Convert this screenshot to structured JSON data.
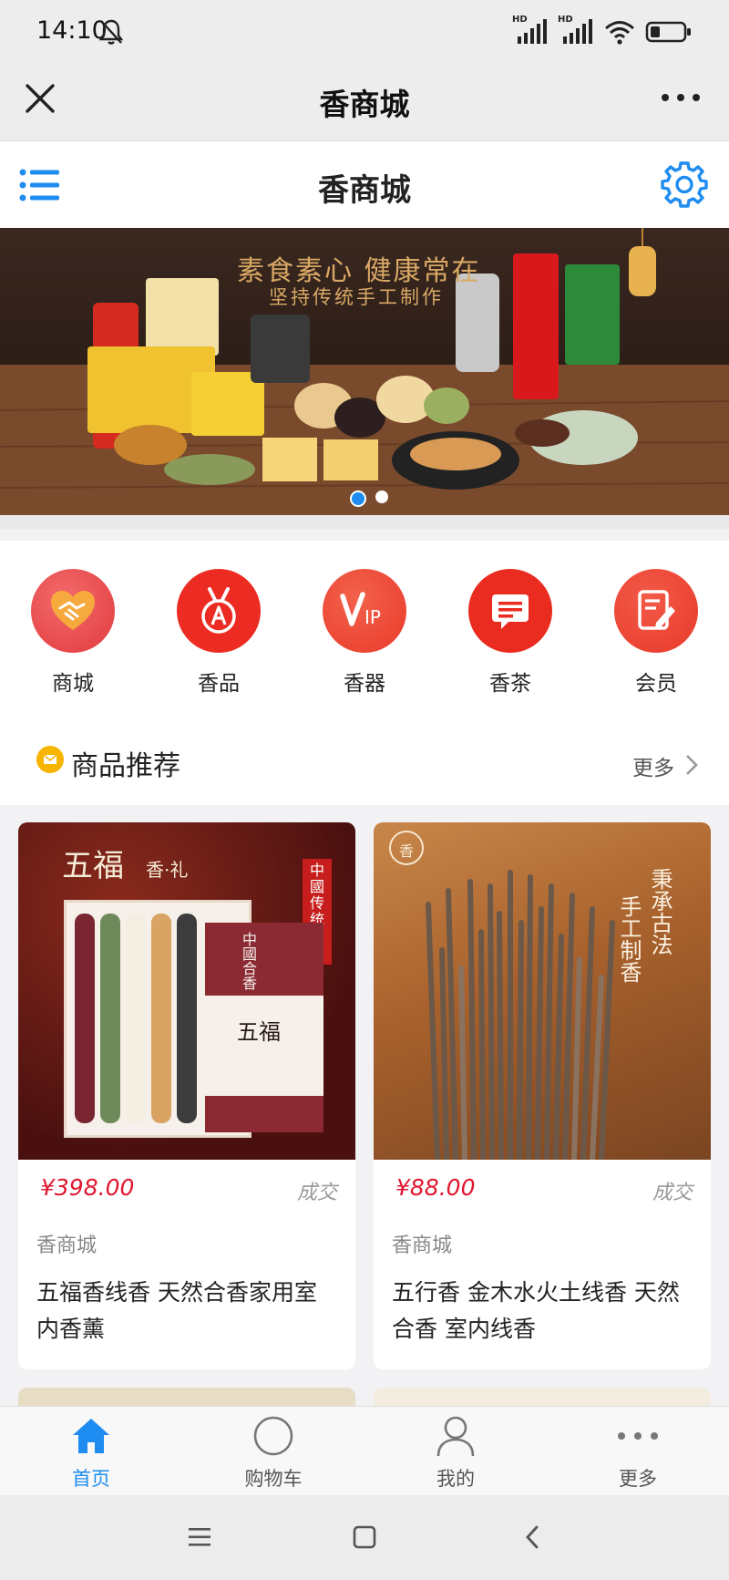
{
  "status_bar": {
    "time": "14:10",
    "network_labels": [
      "HD",
      "HD"
    ]
  },
  "webview": {
    "title": "香商城"
  },
  "app_header": {
    "title": "香商城"
  },
  "banner": {
    "slogan_line1": "素食素心 健康常在",
    "slogan_line2": "坚持传统手工制作",
    "slides_total": 2,
    "active_slide": 1,
    "accent_color": "#1e8cf0"
  },
  "categories": [
    {
      "label": "商城",
      "icon": "handshake-heart-icon"
    },
    {
      "label": "香品",
      "icon": "medal-icon"
    },
    {
      "label": "香器",
      "icon": "vip-icon"
    },
    {
      "label": "香茶",
      "icon": "message-icon"
    },
    {
      "label": "会员",
      "icon": "edit-note-icon"
    }
  ],
  "section": {
    "title": "商品推荐",
    "more_label": "更多"
  },
  "products": [
    {
      "price": "¥398.00",
      "deal_label": "成交",
      "shop": "香商城",
      "name": "五福香线香 天然合香家用室内香薰",
      "image_title": "五福",
      "image_subtitle": "香·礼",
      "image_box_label": "中國合香",
      "image_box_name": "五福",
      "image_side_label": "中國传统合香"
    },
    {
      "price": "¥88.00",
      "deal_label": "成交",
      "shop": "香商城",
      "name": "五行香 金木水火土线香 天然合香 室内线香",
      "image_text_col1": "秉承古法",
      "image_text_col2": "手工制香",
      "image_logo": "香"
    }
  ],
  "tabbar": {
    "items": [
      {
        "label": "首页",
        "icon": "home-icon",
        "active": true
      },
      {
        "label": "购物车",
        "icon": "cart-icon",
        "active": false
      },
      {
        "label": "我的",
        "icon": "user-icon",
        "active": false
      },
      {
        "label": "更多",
        "icon": "more-dots-icon",
        "active": false
      }
    ]
  },
  "colors": {
    "price_red": "#e0182f",
    "category_red": "#ec3a2a",
    "brand_blue": "#1e8cf0"
  }
}
